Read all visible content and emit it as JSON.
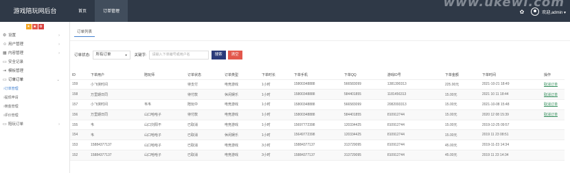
{
  "brand": "游戏陪玩网后台",
  "watermark": "www.ukewi.com",
  "nav": [
    {
      "label": "首页",
      "active": false
    },
    {
      "label": "订单管理",
      "active": true
    }
  ],
  "topright": {
    "gear_icon": "gear-icon",
    "avatar_icon": "user-circle-icon",
    "user_label": "欢迎,admin ▾"
  },
  "sidebar": {
    "shortcuts": [
      "★",
      "■",
      "✿"
    ],
    "items": [
      {
        "icon": "gears-icon",
        "glyph": "⚙",
        "label": "设置",
        "arrow": "›"
      },
      {
        "icon": "users-icon",
        "glyph": "👥",
        "label": "用户管理",
        "arrow": "›"
      },
      {
        "icon": "grid-icon",
        "glyph": "▦",
        "label": "内容管理",
        "arrow": "›"
      },
      {
        "icon": "terminal-icon",
        "glyph": "▭",
        "label": "安全记录",
        "arrow": ""
      },
      {
        "icon": "sign-in-icon",
        "glyph": "⇥",
        "label": "模板管理",
        "arrow": ""
      },
      {
        "icon": "monitor-icon",
        "glyph": "▭",
        "label": "订单订单",
        "arrow": "⌄",
        "open": true
      }
    ],
    "sub_items": [
      {
        "label": "›订单管理",
        "active": true
      },
      {
        "label": "›提现申请",
        "active": false
      },
      {
        "label": "›佣金管理",
        "active": false
      },
      {
        "label": "›评价管理",
        "active": false
      }
    ],
    "last_item": {
      "icon": "monitor-icon",
      "glyph": "▭",
      "label": "陪玩订单",
      "arrow": "›"
    }
  },
  "tab": "订单列表",
  "filter": {
    "status_label": "订单状态:",
    "status_value": "所有订单",
    "keyword_label": "关键字:",
    "keyword_placeholder": "请输入下单编号或用户名",
    "search_btn": "搜索",
    "clear_btn": "清空"
  },
  "table": {
    "headers": [
      "ID",
      "下单用户",
      "陪玩师",
      "订单状态",
      "订单类型",
      "下单时长",
      "下单手机",
      "下单QQ",
      "游戏ID号",
      "下单金额",
      "下单时间",
      "操作"
    ],
    "rows": [
      [
        "159",
        "小飞侠时间",
        "",
        "待支付",
        "电竞游戏",
        "1小时",
        "15800348888",
        "566583099",
        "1381390313",
        "225.00元",
        "2021-10-21 18:49",
        "取消订单"
      ],
      [
        "158",
        "万里期日同",
        "",
        "待付款",
        "休闲娱乐",
        "1小时",
        "15800348888",
        "584401855",
        "1181456313",
        "15.00元",
        "2021 10 11 18:44",
        "取消订单"
      ],
      [
        "157",
        "小飞侠时间",
        "韦韦",
        "陪玩中",
        "电竞游戏",
        "1小时",
        "15800348888",
        "566583099",
        "2082093313",
        "15.00元",
        "2021-10-08 15:48",
        "取消订单"
      ],
      [
        "156",
        "万里期日同",
        "山口哈哈子",
        "待付款",
        "电竞游戏",
        "1小时",
        "15800348888",
        "584401855",
        "810912744",
        "15.00元",
        "2020 12 08 15:39",
        "取消订单"
      ],
      [
        "155",
        "韦",
        "山口刘阳不",
        "已取消",
        "电竞游戏",
        "1小时",
        "15697772398",
        "120334425",
        "810912744",
        "15.00元",
        "2019-12-25 09:57",
        ""
      ],
      [
        "154",
        "韦",
        "山口哈哈子",
        "已取消",
        "休闲娱乐",
        "1小时",
        "15649772398",
        "120334425",
        "810912744",
        "15.00元",
        "2019 11 23 08:51",
        ""
      ],
      [
        "153",
        "15884377137",
        "山口哈哈子",
        "已取消",
        "电竞游戏",
        "3小时",
        "15884377137",
        "313729095",
        "810912744",
        "45.00元",
        "2019-11-23 14:34",
        ""
      ],
      [
        "152",
        "15884377137",
        "山口哈哈子",
        "已取消",
        "电竞游戏",
        "3小时",
        "15884377137",
        "313729095",
        "810912744",
        "45.00元",
        "2019 11 23 14:34",
        ""
      ]
    ]
  }
}
